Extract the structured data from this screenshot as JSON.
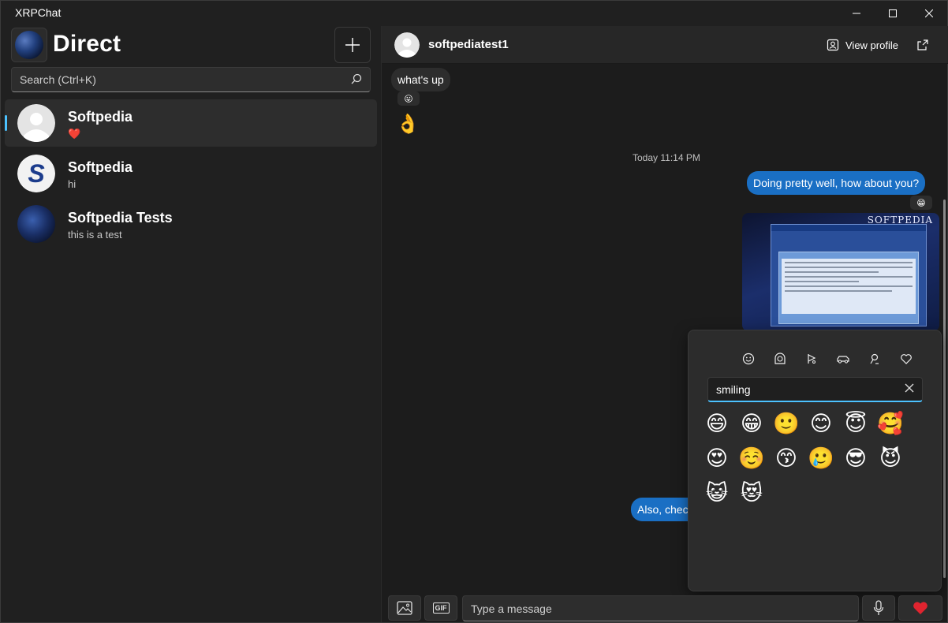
{
  "window": {
    "title": "XRPChat"
  },
  "sidebar": {
    "title": "Direct",
    "search_placeholder": "Search (Ctrl+K)",
    "conversations": [
      {
        "name": "Softpedia",
        "preview": "❤️",
        "selected": true
      },
      {
        "name": "Softpedia",
        "preview": "hi",
        "selected": false
      },
      {
        "name": "Softpedia Tests",
        "preview": "this is a test",
        "selected": false
      }
    ]
  },
  "chat": {
    "contact_name": "softpediatest1",
    "view_profile_label": "View profile",
    "messages": {
      "incoming_text": "what's up",
      "incoming_reaction": "😛",
      "incoming_emoji": "👌",
      "timestamp": "Today 11:14 PM",
      "outgoing_text_1": "Doing pretty well, how about you?",
      "outgoing_reaction": "😁",
      "image_brand": "SOFTPEDIA",
      "outgoing_text_2": "Also, chec"
    },
    "composer_placeholder": "Type a message",
    "gif_label": "GIF",
    "send_emoji": "❤️"
  },
  "emoji_picker": {
    "categories": [
      "smileys-icon",
      "people-icon",
      "nature-icon",
      "travel-icon",
      "places-icon",
      "symbols-icon"
    ],
    "search_value": "smiling",
    "results": [
      "😄",
      "😁",
      "🙂",
      "😊",
      "😇",
      "🥰",
      "😍",
      "☺️",
      "😙",
      "🥲",
      "😎",
      "😈",
      "😺",
      "😻"
    ]
  },
  "colors": {
    "accent": "#4cc2ff",
    "outgoing_bubble": "#1a6fc4",
    "heart": "#e0242f"
  }
}
